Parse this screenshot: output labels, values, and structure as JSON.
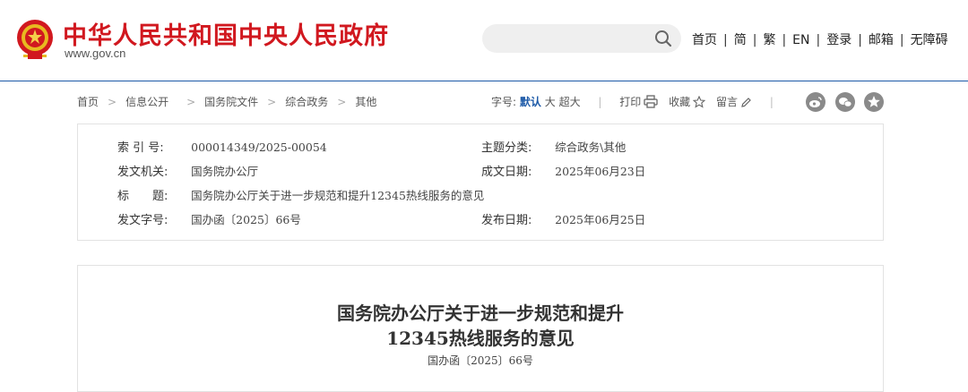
{
  "header": {
    "site_title": "中华人民共和国中央人民政府",
    "site_url": "www.gov.cn",
    "search_placeholder": "",
    "nav": [
      "首页",
      "简",
      "繁",
      "EN",
      "登录",
      "邮箱",
      "无障碍"
    ]
  },
  "breadcrumb": [
    "首页",
    "信息公开",
    "国务院文件",
    "综合政务",
    "其他"
  ],
  "tools": {
    "font_label": "字号:",
    "font_default": "默认",
    "font_large": "大",
    "font_xlarge": "超大",
    "print": "打印",
    "favorite": "收藏",
    "comment": "留言"
  },
  "social_icons": [
    "weibo-icon",
    "wechat-icon",
    "star-icon"
  ],
  "meta": {
    "index_label": "索 引 号:",
    "index_value": "000014349/2025-00054",
    "category_label": "主题分类:",
    "category_value": "综合政务\\其他",
    "issuer_label": "发文机关:",
    "issuer_value": "国务院办公厅",
    "written_label": "成文日期:",
    "written_value": "2025年06月23日",
    "title_label": "标　　题:",
    "title_value": "国务院办公厅关于进一步规范和提升12345热线服务的意见",
    "docnum_label": "发文字号:",
    "docnum_value": "国办函〔2025〕66号",
    "published_label": "发布日期:",
    "published_value": "2025年06月25日"
  },
  "article": {
    "title_line1": "国务院办公厅关于进一步规范和提升",
    "title_line2": "12345热线服务的意见",
    "doc_number": "国办函〔2025〕66号"
  },
  "colors": {
    "brand_red": "#d1181f",
    "accent_blue": "#1d5aa8",
    "border": "#e2e2e2"
  }
}
